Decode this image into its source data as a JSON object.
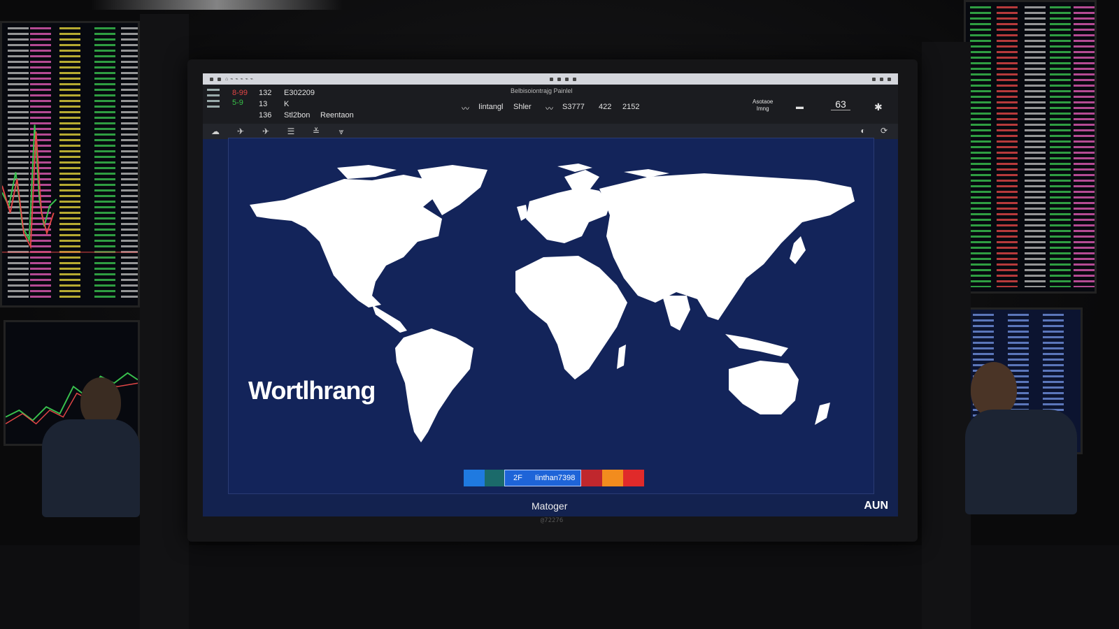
{
  "window": {
    "titlebar_text": "⌂ ⌁ ⌁ ⌁ ⌁ ⌁",
    "center_title": "Belbisoiontrajg Painlel"
  },
  "header": {
    "col1": {
      "r1": "132",
      "r2": "13",
      "r3": "136"
    },
    "col1_flags": {
      "r1": "8-99",
      "r2": "5-9"
    },
    "col2": {
      "r1": "E302209",
      "r2": "K",
      "r3": "Stl2bon"
    },
    "col3": {
      "r3": "Reentaon"
    },
    "center": {
      "label1": "Iintangl",
      "label2": "Shler",
      "value1": "S3777",
      "value2": "422",
      "value3": "2152"
    },
    "right_label": "Asotaoe\nImng",
    "right_value": "63"
  },
  "toolbar": {
    "icons": [
      "cloud-icon",
      "plane-icon",
      "plane-icon",
      "lines-icon",
      "filter-icon",
      "chart-icon"
    ]
  },
  "map": {
    "title": "Wortlhrang",
    "land_color": "#ffffff",
    "ocean_color": "#13245a"
  },
  "legend": {
    "label_prefix": "2F",
    "label_text": "Iinthan7398",
    "colors": [
      "#1f7ae0",
      "#1b6a6a",
      "#1e64d8",
      "#c0272d",
      "#f28c1e",
      "#e02a2a"
    ]
  },
  "status": {
    "center_text": "Matoger",
    "right_text": "AUN"
  },
  "bezel": {
    "text": "@72276"
  },
  "colors": {
    "screen_bg": "#13224f",
    "header_bg": "#1b1c20",
    "positive": "#38c24a",
    "negative": "#e14646"
  }
}
